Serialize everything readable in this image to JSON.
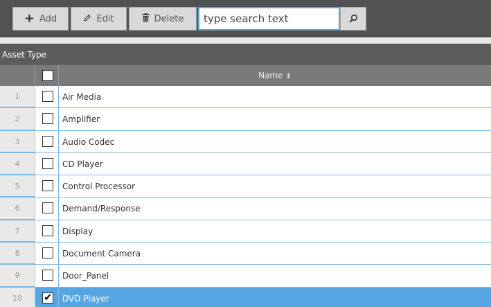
{
  "toolbar": {
    "add_icon": "plus-icon",
    "add_glyph": "+",
    "add_label": "Add",
    "edit_icon": "pencil-icon",
    "edit_glyph": "✏",
    "edit_label": "Edit",
    "delete_icon": "trash-icon",
    "delete_glyph": "🗑",
    "delete_label": "Delete",
    "search_placeholder": "type search text",
    "search_value": "",
    "search_icon": "magnifier-icon"
  },
  "grid": {
    "title": "Asset Type",
    "column_name": "Name",
    "sort_icon": "sort-both-icon",
    "sort_glyph": "⬍",
    "rows": [
      {
        "num": "1",
        "name": "Air Media",
        "checked": false
      },
      {
        "num": "2",
        "name": "Amplifier",
        "checked": false
      },
      {
        "num": "3",
        "name": "Audio Codec",
        "checked": false
      },
      {
        "num": "4",
        "name": "CD Player",
        "checked": false
      },
      {
        "num": "5",
        "name": "Control Processor",
        "checked": false
      },
      {
        "num": "6",
        "name": "Demand/Response",
        "checked": false
      },
      {
        "num": "7",
        "name": "Display",
        "checked": false
      },
      {
        "num": "8",
        "name": "Document Camera",
        "checked": false
      },
      {
        "num": "9",
        "name": "Door_Panel",
        "checked": false
      },
      {
        "num": "10",
        "name": "DVD Player",
        "checked": true
      }
    ]
  },
  "colors": {
    "toolbar_bg": "#525252",
    "header_bg": "#7a7a7a",
    "selected_row": "#56a6e3",
    "row_border": "#7fb7e0"
  }
}
